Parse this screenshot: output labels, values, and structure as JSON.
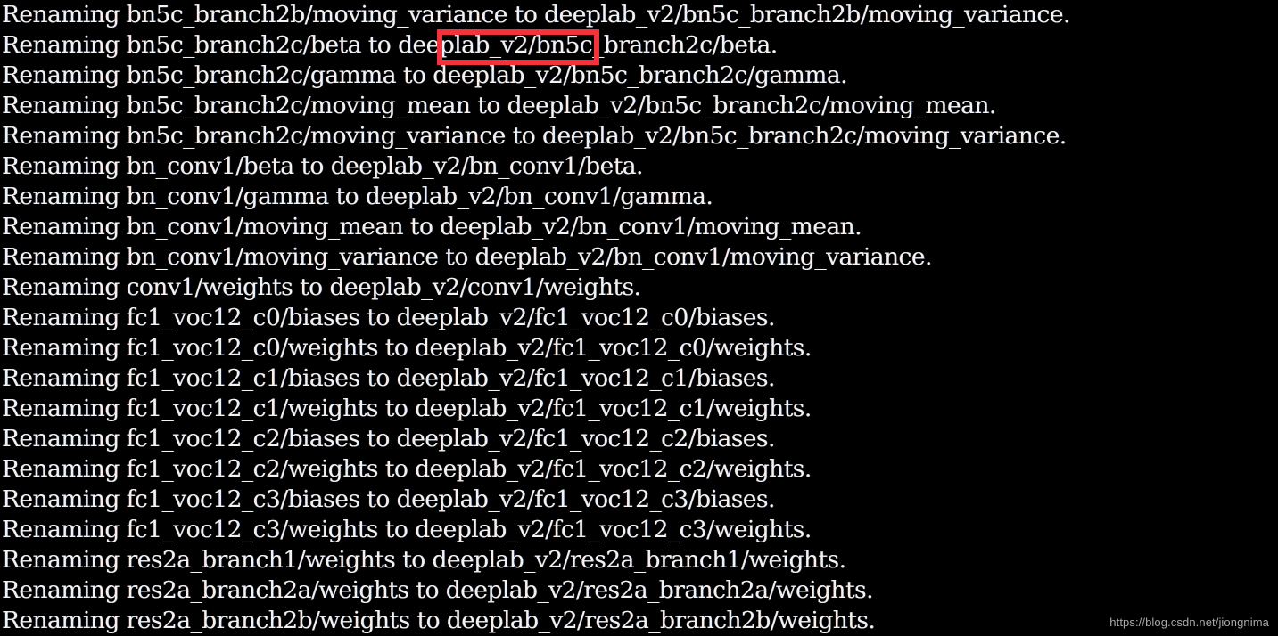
{
  "window": {
    "type": "terminal-console-output",
    "background_color": "#000000",
    "text_color": "#f2f2f2"
  },
  "console": {
    "lines": [
      "Renaming bn5c_branch2b/moving_variance to deeplab_v2/bn5c_branch2b/moving_variance.",
      "Renaming bn5c_branch2c/beta to deeplab_v2/bn5c_branch2c/beta.",
      "Renaming bn5c_branch2c/gamma to deeplab_v2/bn5c_branch2c/gamma.",
      "Renaming bn5c_branch2c/moving_mean to deeplab_v2/bn5c_branch2c/moving_mean.",
      "Renaming bn5c_branch2c/moving_variance to deeplab_v2/bn5c_branch2c/moving_variance.",
      "Renaming bn_conv1/beta to deeplab_v2/bn_conv1/beta.",
      "Renaming bn_conv1/gamma to deeplab_v2/bn_conv1/gamma.",
      "Renaming bn_conv1/moving_mean to deeplab_v2/bn_conv1/moving_mean.",
      "Renaming bn_conv1/moving_variance to deeplab_v2/bn_conv1/moving_variance.",
      "Renaming conv1/weights to deeplab_v2/conv1/weights.",
      "Renaming fc1_voc12_c0/biases to deeplab_v2/fc1_voc12_c0/biases.",
      "Renaming fc1_voc12_c0/weights to deeplab_v2/fc1_voc12_c0/weights.",
      "Renaming fc1_voc12_c1/biases to deeplab_v2/fc1_voc12_c1/biases.",
      "Renaming fc1_voc12_c1/weights to deeplab_v2/fc1_voc12_c1/weights.",
      "Renaming fc1_voc12_c2/biases to deeplab_v2/fc1_voc12_c2/biases.",
      "Renaming fc1_voc12_c2/weights to deeplab_v2/fc1_voc12_c2/weights.",
      "Renaming fc1_voc12_c3/biases to deeplab_v2/fc1_voc12_c3/biases.",
      "Renaming fc1_voc12_c3/weights to deeplab_v2/fc1_voc12_c3/weights.",
      "Renaming res2a_branch1/weights to deeplab_v2/res2a_branch1/weights.",
      "Renaming res2a_branch2a/weights to deeplab_v2/res2a_branch2a/weights.",
      "Renaming res2a_branch2b/weights to deeplab_v2/res2a_branch2b/weights."
    ]
  },
  "annotation": {
    "highlight_token": "deeplab_v2",
    "highlight_line_index": 1,
    "color": "#f4323c"
  },
  "watermark": {
    "text": "https://blog.csdn.net/jiongnima",
    "color": "#a8a8a8"
  }
}
